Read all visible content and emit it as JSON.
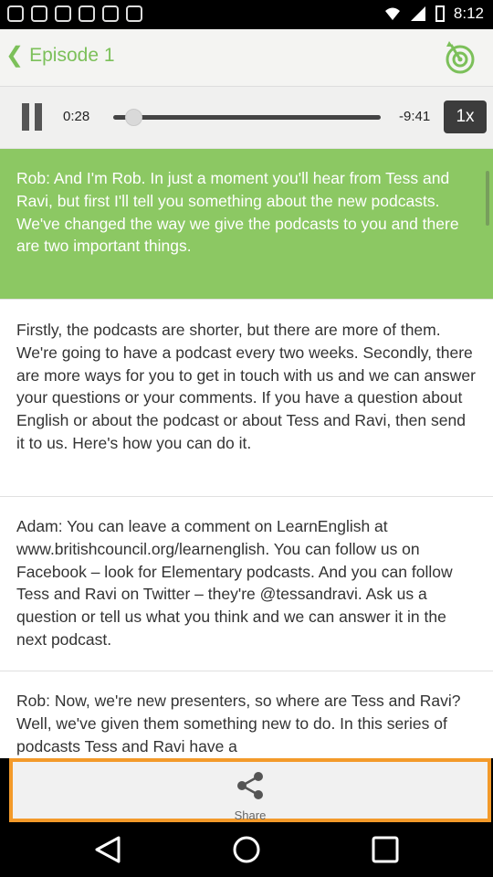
{
  "status": {
    "time": "8:12"
  },
  "header": {
    "title": "Episode 1"
  },
  "player": {
    "current_time": "0:28",
    "remaining_time": "-9:41",
    "speed": "1x",
    "progress": 0.047
  },
  "transcript": [
    "Rob: And I'm Rob. In just a moment you'll hear from Tess and Ravi, but first I'll tell you something about the new podcasts. We've changed the way we give the podcasts to you and there are two important things.",
    "Firstly, the podcasts are shorter, but there are more of them. We're going to have a podcast every two weeks. Secondly, there are more ways for you to get in touch with us and we can answer your questions or your comments. If you have a question about English or about the podcast or about Tess and Ravi, then send it to us. Here's how you can do it.",
    "Adam: You can leave a comment on LearnEnglish at www.britishcouncil.org/learnenglish. You can follow us on Facebook – look for Elementary podcasts. And you can follow Tess and Ravi on Twitter – they're @tessandravi. Ask us a question or tell us what you think and we can answer it in the next podcast.",
    "Rob: Now, we're new presenters, so where are Tess and Ravi? Well, we've given them something new to do. In this series of podcasts Tess and Ravi have a"
  ],
  "share": {
    "label": "Share"
  },
  "colors": {
    "accent": "#8cc863",
    "highlight": "#f39a2a"
  }
}
